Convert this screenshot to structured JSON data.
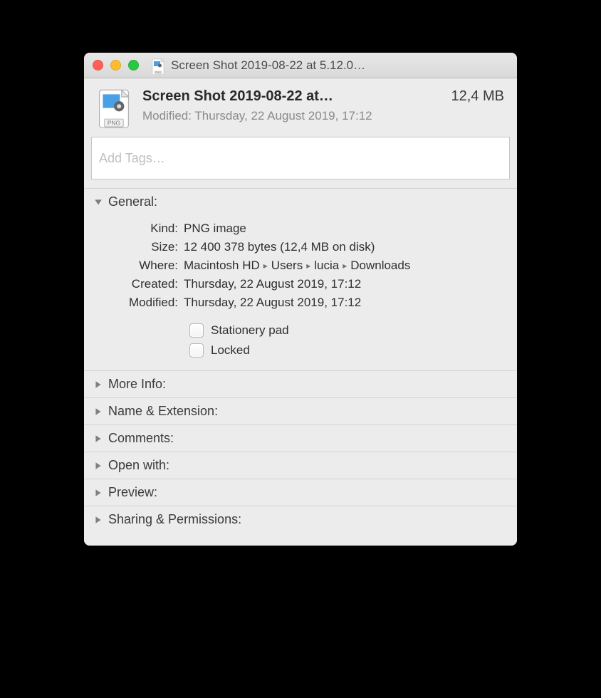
{
  "titlebar": {
    "title": "Screen Shot 2019-08-22 at 5.12.0…"
  },
  "header": {
    "file_name": "Screen Shot 2019-08-22 at…",
    "file_size": "12,4 MB",
    "modified_label": "Modified:",
    "modified_value": "Thursday, 22 August 2019, 17:12"
  },
  "tags": {
    "placeholder": "Add Tags…"
  },
  "sections": {
    "general": {
      "title": "General:",
      "items": {
        "kind": {
          "label": "Kind:",
          "value": "PNG image"
        },
        "size": {
          "label": "Size:",
          "value": "12 400 378 bytes (12,4 MB on disk)"
        },
        "where": {
          "label": "Where:",
          "segments": [
            "Macintosh HD",
            "Users",
            "lucia",
            "Downloads"
          ]
        },
        "created": {
          "label": "Created:",
          "value": "Thursday, 22 August 2019, 17:12"
        },
        "modified": {
          "label": "Modified:",
          "value": "Thursday, 22 August 2019, 17:12"
        }
      },
      "checks": {
        "stationery": "Stationery pad",
        "locked": "Locked"
      }
    },
    "more_info": {
      "title": "More Info:"
    },
    "name_ext": {
      "title": "Name & Extension:"
    },
    "comments": {
      "title": "Comments:"
    },
    "open_with": {
      "title": "Open with:"
    },
    "preview": {
      "title": "Preview:"
    },
    "sharing": {
      "title": "Sharing & Permissions:"
    }
  }
}
